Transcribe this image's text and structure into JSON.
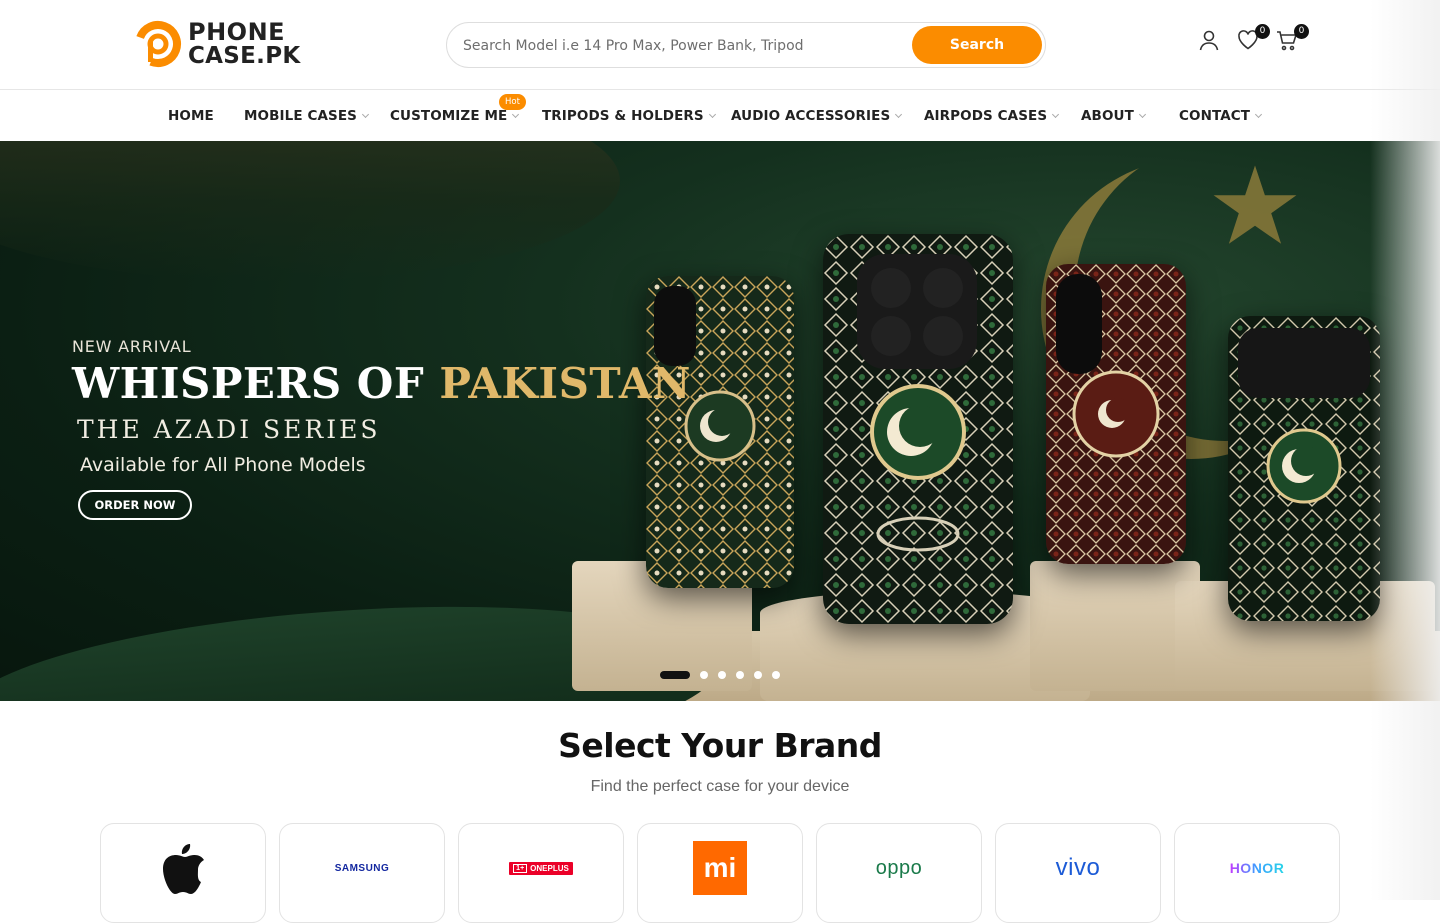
{
  "header": {
    "logo": {
      "line1": "PHONE",
      "line2": "CASE.PK"
    },
    "search": {
      "placeholder": "Search Model i.e 14 Pro Max, Power Bank, Tripod",
      "button_label": "Search"
    },
    "wishlist_count": "0",
    "cart_count": "0"
  },
  "nav": {
    "items": [
      {
        "label": "HOME"
      },
      {
        "label": "MOBILE CASES"
      },
      {
        "label": "CUSTOMIZE ME"
      },
      {
        "label": "TRIPODS & HOLDERS"
      },
      {
        "label": "AUDIO ACCESSORIES"
      },
      {
        "label": "AIRPODS CASES"
      },
      {
        "label": "ABOUT"
      },
      {
        "label": "CONTACT"
      }
    ],
    "hot_badge": "Hot"
  },
  "hero": {
    "kicker": "NEW ARRIVAL",
    "title_part1": "WHISPERS OF ",
    "title_part2": "PAKISTAN",
    "subtitle": "THE AZADI SERIES",
    "availability": "Available for All Phone Models",
    "cta": "ORDER NOW",
    "slides": 6,
    "active_slide": 1
  },
  "brands": {
    "title": "Select Your Brand",
    "subtitle": "Find the perfect case for your device",
    "items": [
      {
        "name": "Apple",
        "logo_text": ""
      },
      {
        "name": "Samsung",
        "logo_text": "SAMSUNG"
      },
      {
        "name": "OnePlus",
        "logo_text": "ONEPLUS"
      },
      {
        "name": "Xiaomi",
        "logo_text": "mi"
      },
      {
        "name": "Oppo",
        "logo_text": "oppo"
      },
      {
        "name": "Vivo",
        "logo_text": "vivo"
      },
      {
        "name": "Honor",
        "logo_text": "HONOR"
      }
    ]
  },
  "colors": {
    "accent": "#fb8c00",
    "hero_bg": "#0b1f13",
    "gold": "#e0b86a"
  }
}
